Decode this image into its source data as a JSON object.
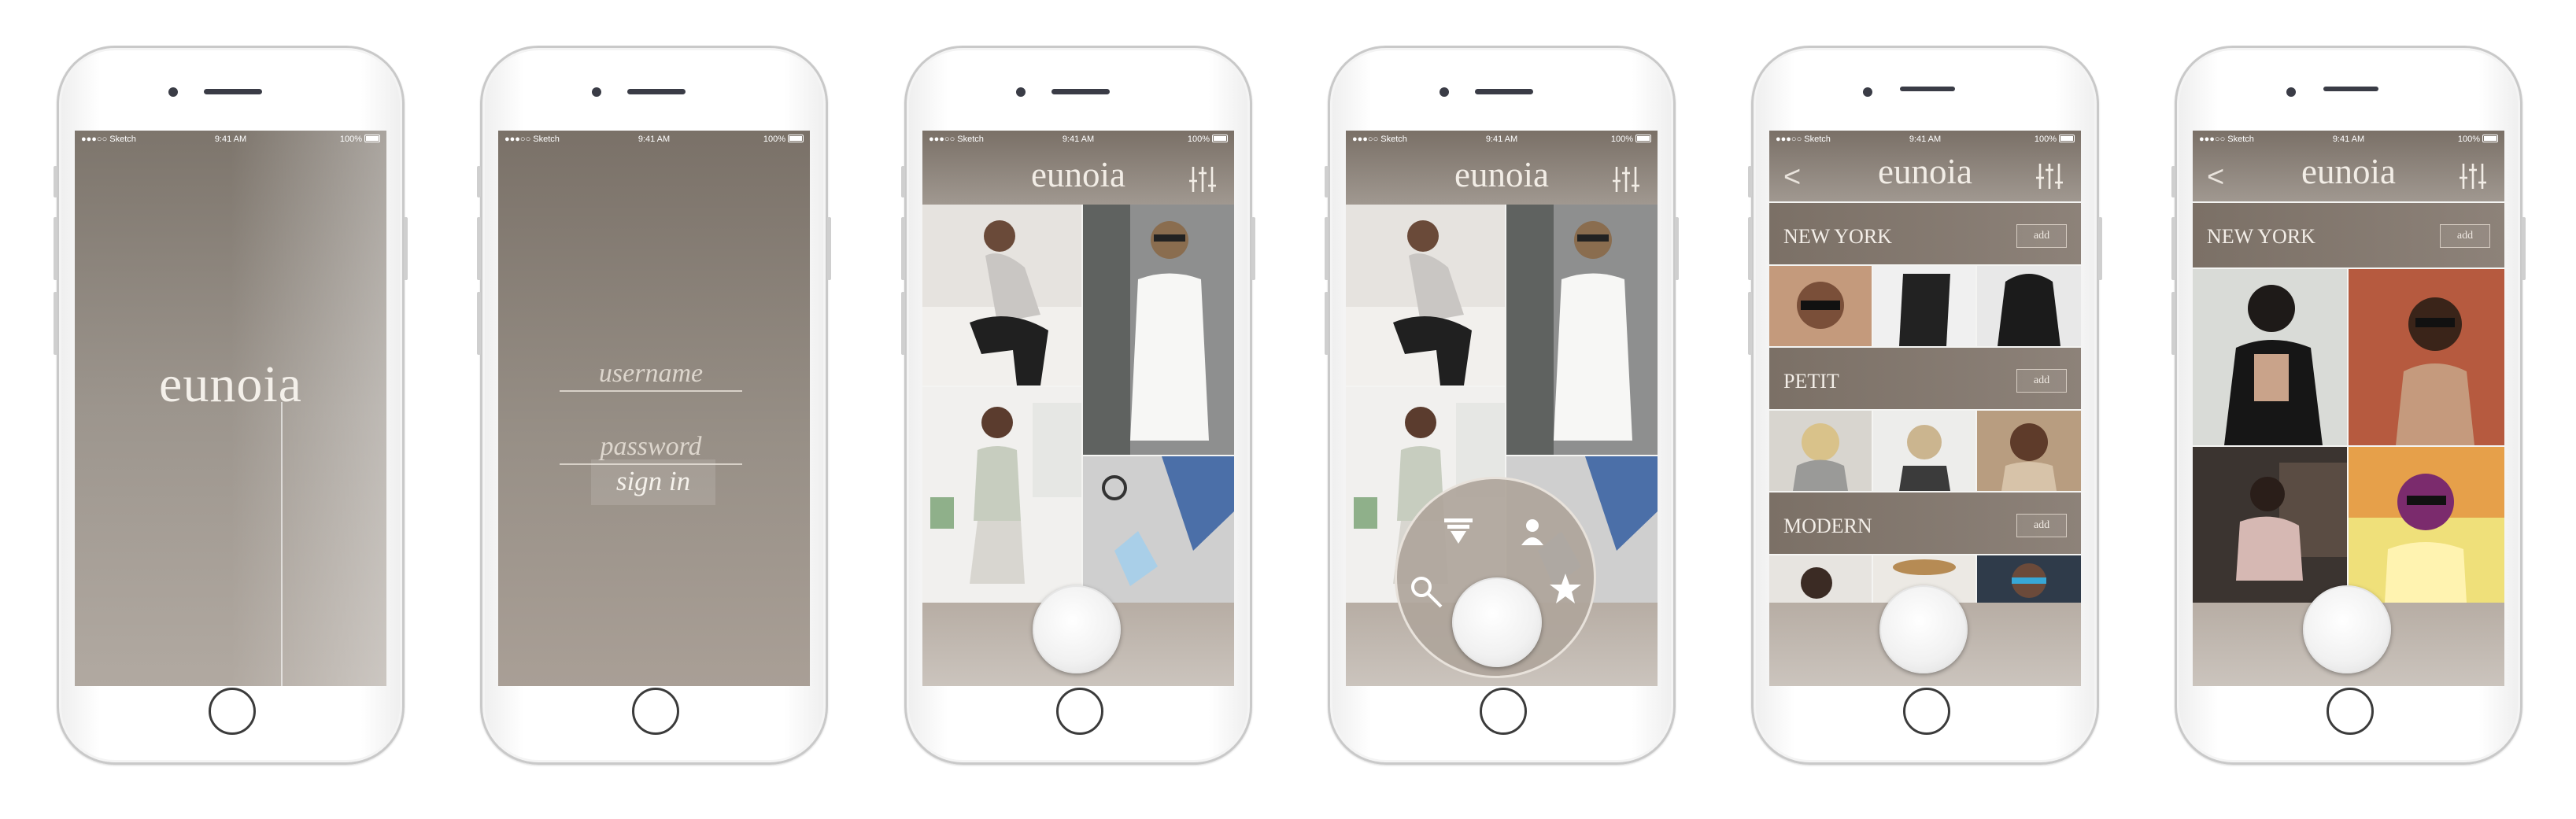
{
  "status": {
    "carrier": "●●●○○ Sketch",
    "time": "9:41 AM",
    "battery": "100%"
  },
  "brand": {
    "name": "eunoia"
  },
  "login": {
    "username": "username",
    "password": "password",
    "signin": "sign in"
  },
  "menu": {
    "back": "<"
  },
  "categories": [
    {
      "name": "NEW YORK",
      "add": "add"
    },
    {
      "name": "PETIT",
      "add": "add"
    },
    {
      "name": "MODERN",
      "add": "add"
    }
  ],
  "detail": {
    "title": "NEW YORK",
    "add": "add"
  },
  "colors": {
    "taupe": "#7a7067",
    "cream": "#f2ede6",
    "fab": "#ffffff"
  }
}
